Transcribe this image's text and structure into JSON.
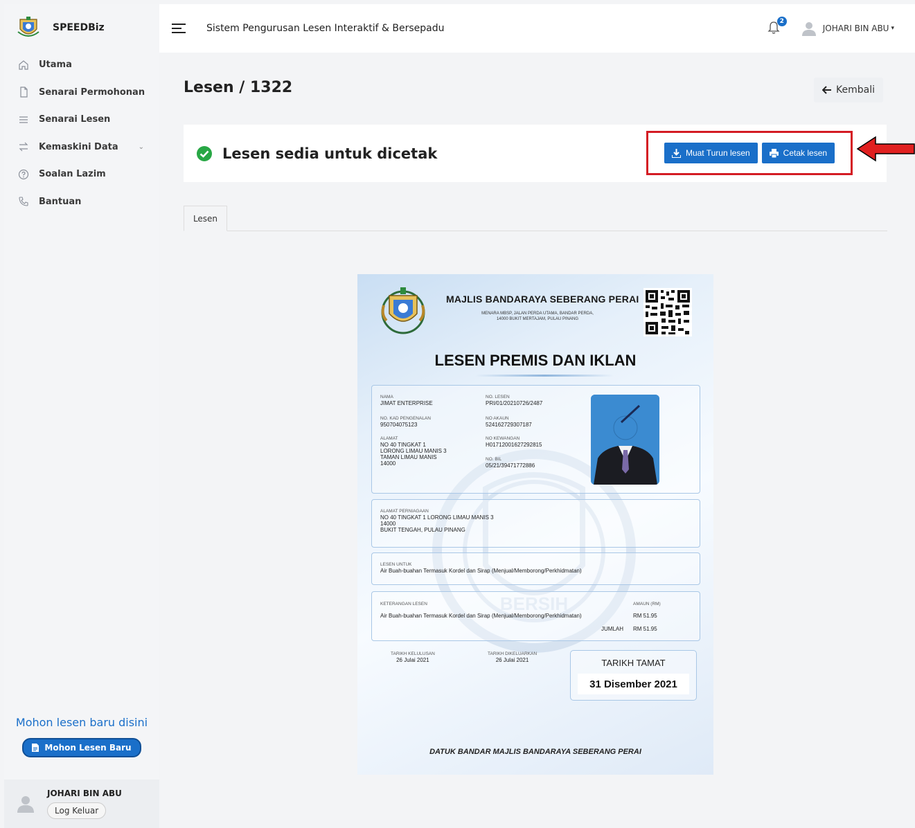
{
  "sidebar": {
    "brand": "SPEEDBiz",
    "items": [
      {
        "label": "Utama",
        "icon": "home-icon"
      },
      {
        "label": "Senarai Permohonan",
        "icon": "file-icon"
      },
      {
        "label": "Senarai Lesen",
        "icon": "list-icon"
      },
      {
        "label": "Kemaskini Data",
        "icon": "swap-icon"
      },
      {
        "label": "Soalan Lazim",
        "icon": "help-icon"
      },
      {
        "label": "Bantuan",
        "icon": "phone-icon"
      }
    ],
    "apply_title": "Mohon lesen baru disini",
    "apply_button": "Mohon Lesen Baru",
    "user_name": "JOHARI BIN ABU",
    "logout": "Log Keluar"
  },
  "topbar": {
    "title": "Sistem Pengurusan Lesen Interaktif & Bersepadu",
    "notification_count": "2",
    "user_name": "JOHARI BIN ABU"
  },
  "page": {
    "title": "Lesen / 1322",
    "back_label": "Kembali",
    "status_text": "Lesen sedia untuk dicetak",
    "download_label": "Muat Turun lesen",
    "print_label": "Cetak lesen",
    "tab_label": "Lesen"
  },
  "license": {
    "org": "MAJLIS BANDARAYA SEBERANG PERAI",
    "address_line1": "MENARA MBSP, JALAN PERDA UTAMA, BANDAR PERDA,",
    "address_line2": "14000 BUKIT MERTAJAM, PULAU PINANG",
    "title": "LESEN PREMIS DAN IKLAN",
    "nama_label": "NAMA",
    "nama": "JIMAT ENTERPRISE",
    "no_lesen_label": "NO. LESEN",
    "no_lesen": "PRI/01/20210726/2487",
    "kad_label": "NO. KAD PENGENALAN",
    "kad": "950704075123",
    "akaun_label": "NO AKAUN",
    "akaun": "524162729307187",
    "alamat_label": "ALAMAT",
    "alamat1": "NO 40 TINGKAT 1",
    "alamat2": "LORONG LIMAU MANIS 3",
    "alamat3": "TAMAN LIMAU MANIS",
    "alamat4": "14000",
    "kewangan_label": "NO KEWANGAN",
    "kewangan": "H01712001627292815",
    "bil_label": "NO. BIL",
    "bil": "05/21/39471772886",
    "perniagaan_label": "ALAMAT PERNIAGAAN",
    "perniagaan1": "NO 40 TINGKAT 1 LORONG LIMAU MANIS 3",
    "perniagaan2": "14000",
    "perniagaan3": "BUKIT TENGAH, PULAU PINANG",
    "untuk_label": "LESEN UNTUK",
    "untuk": "Air Buah-buahan Termasuk Kordel dan Sirap (Menjual/Memborong/Perkhidmatan)",
    "keterangan_label": "KETERANGAN LESEN",
    "amaun_label": "AMAUN (RM)",
    "keterangan": "Air Buah-buahan Termasuk Kordel dan Sirap (Menjual/Memborong/Perkhidmatan)",
    "amaun": "RM 51.95",
    "jumlah_label": "JUMLAH",
    "jumlah": "RM 51.95",
    "kelulusan_label": "TARIKH KELULUSAN",
    "kelulusan": "26 Julai 2021",
    "dikeluarkan_label": "TARIKH DIKELUARKAN",
    "dikeluarkan": "26 Julai 2021",
    "tamat_label": "TARIKH TAMAT",
    "tamat": "31 Disember 2021",
    "watermark_text": "BERSIH",
    "signature": "DATUK BANDAR MAJLIS BANDARAYA SEBERANG PERAI"
  },
  "colors": {
    "primary": "#1a6fc9",
    "highlight": "#d41c24",
    "success": "#28a745"
  }
}
